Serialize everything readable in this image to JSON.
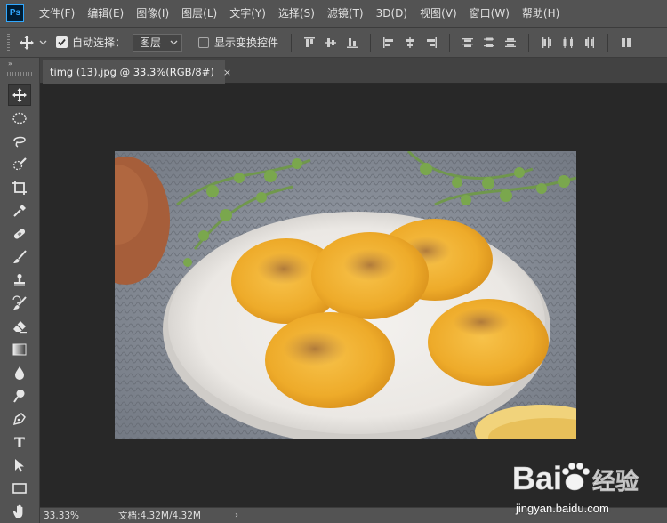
{
  "app": {
    "logo_text": "Ps"
  },
  "menu": {
    "items": [
      "文件(F)",
      "编辑(E)",
      "图像(I)",
      "图层(L)",
      "文字(Y)",
      "选择(S)",
      "滤镜(T)",
      "3D(D)",
      "视图(V)",
      "窗口(W)",
      "帮助(H)"
    ]
  },
  "options_bar": {
    "auto_select_label": "自动选择：",
    "auto_select_checked": true,
    "auto_select_target": "图层",
    "show_transform_label": "显示变换控件",
    "show_transform_checked": false
  },
  "document_tab": {
    "title": "timg (13).jpg @ 33.3%(RGB/8#)",
    "close_glyph": "×"
  },
  "tools": {
    "collapse_glyph": "»",
    "active": "move-tool",
    "type_tool_glyph": "T"
  },
  "status_bar": {
    "zoom": "33.33%",
    "doc_info": "文档:4.32M/4.32M",
    "arrow": "›"
  },
  "watermark": {
    "logo_text": "Bai经验",
    "site": "jingyan.baidu.com"
  },
  "colors": {
    "ps_blue": "#31a8ff",
    "chrome": "#535353",
    "canvas": "#282828"
  }
}
